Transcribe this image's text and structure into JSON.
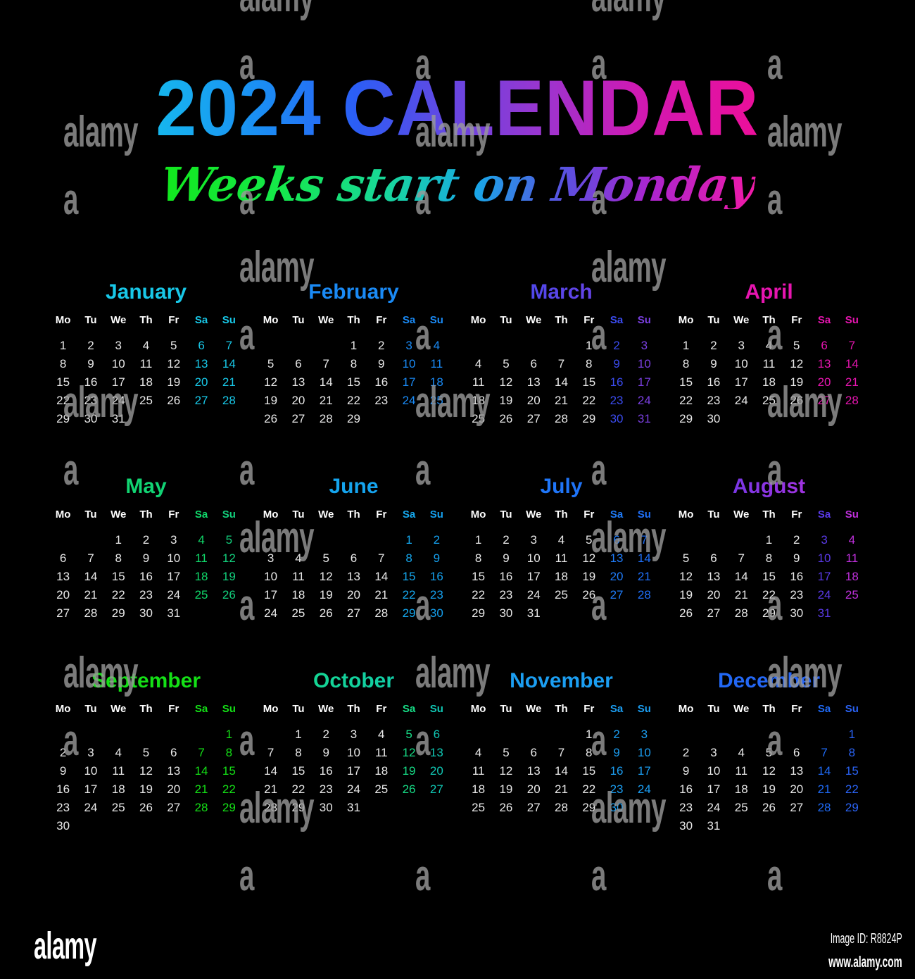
{
  "poster": {
    "background_color": "#000000",
    "title": "2024 CALENDAR",
    "subtitle": "Weeks start on Monday",
    "title_gradient": [
      "#16b7ee",
      "#2b5ef6",
      "#9b35d0",
      "#ec0f9a"
    ],
    "subtitle_gradient": [
      "#12e81c",
      "#18d79b",
      "#18a8e8",
      "#a926cf",
      "#f01aa8"
    ],
    "weekday_headers": [
      "Mo",
      "Tu",
      "We",
      "Th",
      "Fr",
      "Sa",
      "Su"
    ],
    "weekday_color": "#ffffff",
    "day_color": "#e8e8e8"
  },
  "footer": {
    "logo": "alamy",
    "image_id": "Image ID: R8824P",
    "url": "www.alamy.com"
  },
  "watermark": {
    "word": "alamy",
    "letter": "a",
    "color": "#9a9a9a"
  },
  "months": [
    {
      "name": "January",
      "accent": "#18c8e8",
      "accent_end": "#18c8e8",
      "weeks": [
        [
          "1",
          "2",
          "3",
          "4",
          "5",
          "6",
          "7"
        ],
        [
          "8",
          "9",
          "10",
          "11",
          "12",
          "13",
          "14"
        ],
        [
          "15",
          "16",
          "17",
          "18",
          "19",
          "20",
          "21"
        ],
        [
          "22",
          "23",
          "24",
          "25",
          "26",
          "27",
          "28"
        ],
        [
          "29",
          "30",
          "31",
          "",
          "",
          "",
          ""
        ]
      ]
    },
    {
      "name": "February",
      "accent": "#1a8af5",
      "accent_end": "#1a8af5",
      "weeks": [
        [
          "",
          "",
          "",
          "1",
          "2",
          "3",
          "4"
        ],
        [
          "5",
          "6",
          "7",
          "8",
          "9",
          "10",
          "11"
        ],
        [
          "12",
          "13",
          "14",
          "15",
          "16",
          "17",
          "18"
        ],
        [
          "19",
          "20",
          "21",
          "22",
          "23",
          "24",
          "25"
        ],
        [
          "26",
          "27",
          "28",
          "29",
          "",
          "",
          ""
        ]
      ]
    },
    {
      "name": "March",
      "accent": "#3b4cf0",
      "accent_end": "#7a3fe0",
      "weeks": [
        [
          "",
          "",
          "",
          "",
          "1",
          "2",
          "3"
        ],
        [
          "4",
          "5",
          "6",
          "7",
          "8",
          "9",
          "10"
        ],
        [
          "11",
          "12",
          "13",
          "14",
          "15",
          "16",
          "17"
        ],
        [
          "18",
          "19",
          "20",
          "21",
          "22",
          "23",
          "24"
        ],
        [
          "25",
          "26",
          "27",
          "28",
          "29",
          "30",
          "31"
        ]
      ]
    },
    {
      "name": "April",
      "accent": "#e715b0",
      "accent_end": "#e715b0",
      "weeks": [
        [
          "1",
          "2",
          "3",
          "4",
          "5",
          "6",
          "7"
        ],
        [
          "8",
          "9",
          "10",
          "11",
          "12",
          "13",
          "14"
        ],
        [
          "15",
          "16",
          "17",
          "18",
          "19",
          "20",
          "21"
        ],
        [
          "22",
          "23",
          "24",
          "25",
          "26",
          "27",
          "28"
        ],
        [
          "29",
          "30",
          "",
          "",
          "",
          "",
          ""
        ]
      ]
    },
    {
      "name": "May",
      "accent": "#10d96a",
      "accent_end": "#12cf7c",
      "weeks": [
        [
          "",
          "",
          "1",
          "2",
          "3",
          "4",
          "5"
        ],
        [
          "6",
          "7",
          "8",
          "9",
          "10",
          "11",
          "12"
        ],
        [
          "13",
          "14",
          "15",
          "16",
          "17",
          "18",
          "19"
        ],
        [
          "20",
          "21",
          "22",
          "23",
          "24",
          "25",
          "26"
        ],
        [
          "27",
          "28",
          "29",
          "30",
          "31",
          "",
          ""
        ]
      ]
    },
    {
      "name": "June",
      "accent": "#15a8ee",
      "accent_end": "#15a0ee",
      "weeks": [
        [
          "",
          "",
          "",
          "",
          "",
          "1",
          "2"
        ],
        [
          "3",
          "4",
          "5",
          "6",
          "7",
          "8",
          "9"
        ],
        [
          "10",
          "11",
          "12",
          "13",
          "14",
          "15",
          "16"
        ],
        [
          "17",
          "18",
          "19",
          "20",
          "21",
          "22",
          "23"
        ],
        [
          "24",
          "25",
          "26",
          "27",
          "28",
          "29",
          "30"
        ]
      ]
    },
    {
      "name": "July",
      "accent": "#1f7bf8",
      "accent_end": "#1f6ff8",
      "weeks": [
        [
          "1",
          "2",
          "3",
          "4",
          "5",
          "6",
          "7"
        ],
        [
          "8",
          "9",
          "10",
          "11",
          "12",
          "13",
          "14"
        ],
        [
          "15",
          "16",
          "17",
          "18",
          "19",
          "20",
          "21"
        ],
        [
          "22",
          "23",
          "24",
          "25",
          "26",
          "27",
          "28"
        ],
        [
          "29",
          "30",
          "31",
          "",
          "",
          "",
          ""
        ]
      ]
    },
    {
      "name": "August",
      "accent": "#5a3ae8",
      "accent_end": "#c030dd",
      "weeks": [
        [
          "",
          "",
          "",
          "1",
          "2",
          "3",
          "4"
        ],
        [
          "5",
          "6",
          "7",
          "8",
          "9",
          "10",
          "11"
        ],
        [
          "12",
          "13",
          "14",
          "15",
          "16",
          "17",
          "18"
        ],
        [
          "19",
          "20",
          "21",
          "22",
          "23",
          "24",
          "25"
        ],
        [
          "26",
          "27",
          "28",
          "29",
          "30",
          "31",
          ""
        ]
      ]
    },
    {
      "name": "September",
      "accent": "#14e016",
      "accent_end": "#14e016",
      "weeks": [
        [
          "",
          "",
          "",
          "",
          "",
          "",
          "1"
        ],
        [
          "2",
          "3",
          "4",
          "5",
          "6",
          "7",
          "8"
        ],
        [
          "9",
          "10",
          "11",
          "12",
          "13",
          "14",
          "15"
        ],
        [
          "16",
          "17",
          "18",
          "19",
          "20",
          "21",
          "22"
        ],
        [
          "23",
          "24",
          "25",
          "26",
          "27",
          "28",
          "29"
        ],
        [
          "30",
          "",
          "",
          "",
          "",
          "",
          ""
        ]
      ]
    },
    {
      "name": "October",
      "accent": "#16dc86",
      "accent_end": "#10c7b4",
      "weeks": [
        [
          "",
          "1",
          "2",
          "3",
          "4",
          "5",
          "6"
        ],
        [
          "7",
          "8",
          "9",
          "10",
          "11",
          "12",
          "13"
        ],
        [
          "14",
          "15",
          "16",
          "17",
          "18",
          "19",
          "20"
        ],
        [
          "21",
          "22",
          "23",
          "24",
          "25",
          "26",
          "27"
        ],
        [
          "28",
          "29",
          "30",
          "31",
          "",
          "",
          ""
        ]
      ]
    },
    {
      "name": "November",
      "accent": "#1b9ef2",
      "accent_end": "#1b9ef2",
      "weeks": [
        [
          "",
          "",
          "",
          "",
          "1",
          "2",
          "3"
        ],
        [
          "4",
          "5",
          "6",
          "7",
          "8",
          "9",
          "10"
        ],
        [
          "11",
          "12",
          "13",
          "14",
          "15",
          "16",
          "17"
        ],
        [
          "18",
          "19",
          "20",
          "21",
          "22",
          "23",
          "24"
        ],
        [
          "25",
          "26",
          "27",
          "28",
          "29",
          "30",
          ""
        ]
      ]
    },
    {
      "name": "December",
      "accent": "#1f6af5",
      "accent_end": "#2a63f5",
      "weeks": [
        [
          "",
          "",
          "",
          "",
          "",
          "",
          "1"
        ],
        [
          "2",
          "3",
          "4",
          "5",
          "6",
          "7",
          "8"
        ],
        [
          "9",
          "10",
          "11",
          "12",
          "13",
          "14",
          "15"
        ],
        [
          "16",
          "17",
          "18",
          "19",
          "20",
          "21",
          "22"
        ],
        [
          "23",
          "24",
          "25",
          "26",
          "27",
          "28",
          "29"
        ],
        [
          "30",
          "31",
          "",
          "",
          "",
          "",
          ""
        ]
      ]
    }
  ]
}
